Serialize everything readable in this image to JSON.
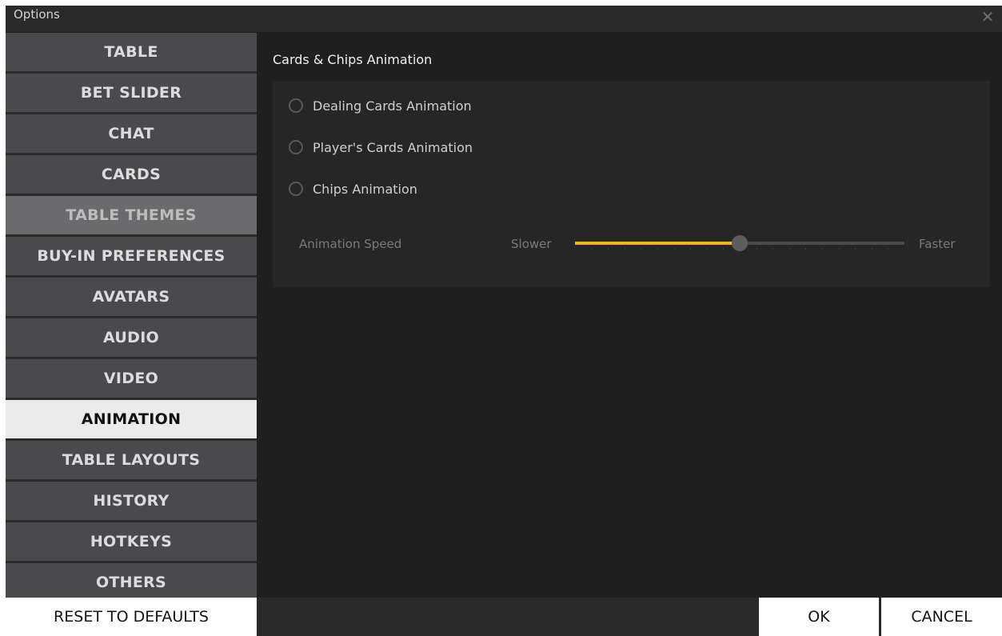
{
  "window": {
    "title": "Options",
    "close_icon": "close-icon"
  },
  "sidebar": {
    "items": [
      {
        "label": "TABLE",
        "state": "normal"
      },
      {
        "label": "BET SLIDER",
        "state": "normal"
      },
      {
        "label": "CHAT",
        "state": "normal"
      },
      {
        "label": "CARDS",
        "state": "normal"
      },
      {
        "label": "TABLE THEMES",
        "state": "dim"
      },
      {
        "label": "BUY-IN PREFERENCES",
        "state": "normal"
      },
      {
        "label": "AVATARS",
        "state": "normal"
      },
      {
        "label": "AUDIO",
        "state": "normal"
      },
      {
        "label": "VIDEO",
        "state": "normal"
      },
      {
        "label": "ANIMATION",
        "state": "active"
      },
      {
        "label": "TABLE LAYOUTS",
        "state": "normal"
      },
      {
        "label": "HISTORY",
        "state": "normal"
      },
      {
        "label": "HOTKEYS",
        "state": "normal"
      },
      {
        "label": "OTHERS",
        "state": "normal"
      }
    ]
  },
  "content": {
    "section_title": "Cards & Chips Animation",
    "options": [
      {
        "label": "Dealing Cards Animation",
        "checked": false
      },
      {
        "label": "Player's Cards Animation",
        "checked": false
      },
      {
        "label": "Chips Animation",
        "checked": false
      }
    ],
    "speed": {
      "label": "Animation Speed",
      "min_label": "Slower",
      "max_label": "Faster",
      "value_fraction": 0.5
    }
  },
  "footer": {
    "reset_label": "RESET TO DEFAULTS",
    "ok_label": "OK",
    "cancel_label": "CANCEL"
  },
  "colors": {
    "accent": "#f0b322",
    "background": "#1f1f1f",
    "nav_item": "#4a4a4e",
    "nav_active": "#ebebeb"
  }
}
